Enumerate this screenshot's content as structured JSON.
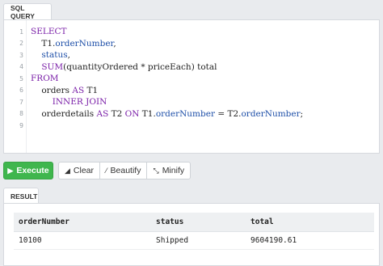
{
  "query_tab": {
    "label": "SQL QUERY"
  },
  "editor": {
    "lines": [
      {
        "num": "1",
        "tokens": [
          {
            "t": "SELECT",
            "c": "kw"
          }
        ]
      },
      {
        "num": "2",
        "tokens": [
          {
            "t": "    T1",
            "c": "plain"
          },
          {
            "t": ".",
            "c": "plain"
          },
          {
            "t": "orderNumber",
            "c": "id"
          },
          {
            "t": ",",
            "c": "plain"
          }
        ]
      },
      {
        "num": "3",
        "tokens": [
          {
            "t": "    status",
            "c": "id"
          },
          {
            "t": ",",
            "c": "plain"
          }
        ]
      },
      {
        "num": "4",
        "tokens": [
          {
            "t": "    ",
            "c": "plain"
          },
          {
            "t": "SUM",
            "c": "fn"
          },
          {
            "t": "(quantityOrdered * priceEach) total",
            "c": "plain"
          }
        ]
      },
      {
        "num": "5",
        "tokens": [
          {
            "t": "FROM",
            "c": "kw"
          }
        ]
      },
      {
        "num": "6",
        "tokens": [
          {
            "t": "    orders ",
            "c": "plain"
          },
          {
            "t": "AS",
            "c": "kw"
          },
          {
            "t": " T1",
            "c": "plain"
          }
        ]
      },
      {
        "num": "7",
        "tokens": [
          {
            "t": "        ",
            "c": "plain"
          },
          {
            "t": "INNER JOIN",
            "c": "kw"
          }
        ]
      },
      {
        "num": "8",
        "tokens": [
          {
            "t": "    orderdetails ",
            "c": "plain"
          },
          {
            "t": "AS",
            "c": "kw"
          },
          {
            "t": " T2 ",
            "c": "plain"
          },
          {
            "t": "ON",
            "c": "kw"
          },
          {
            "t": " T1.",
            "c": "plain"
          },
          {
            "t": "orderNumber",
            "c": "id"
          },
          {
            "t": " = T2.",
            "c": "plain"
          },
          {
            "t": "orderNumber",
            "c": "id"
          },
          {
            "t": ";",
            "c": "plain"
          }
        ]
      },
      {
        "num": "9",
        "tokens": []
      }
    ]
  },
  "toolbar": {
    "execute_label": "Execute",
    "execute_icon": "play-icon",
    "clear_label": "Clear",
    "clear_icon": "eraser-icon",
    "beautify_label": "Beautify",
    "beautify_icon": "magic-wand-icon",
    "minify_label": "Minify",
    "minify_icon": "compress-icon",
    "execute_color": "#3fb64d"
  },
  "result_tab": {
    "label": "RESULT"
  },
  "result": {
    "columns": [
      "orderNumber",
      "status",
      "total"
    ],
    "rows": [
      [
        "10100",
        "Shipped",
        "9604190.61"
      ]
    ]
  }
}
